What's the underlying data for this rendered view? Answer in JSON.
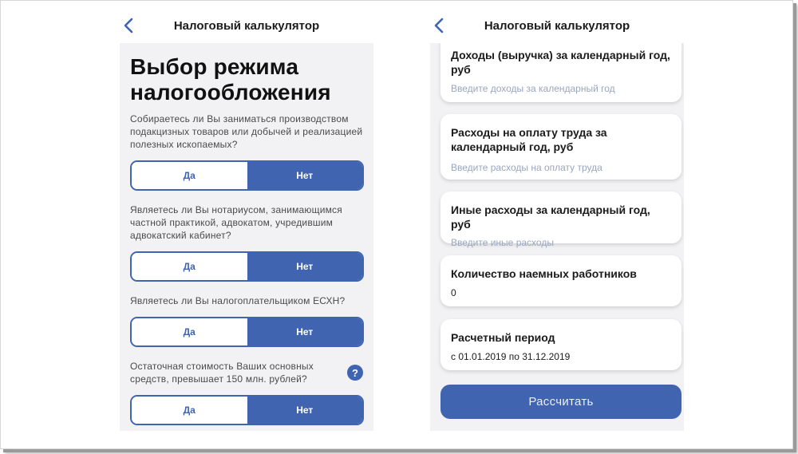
{
  "left": {
    "nav_title": "Налоговый калькулятор",
    "heading_line1": "Выбор режима",
    "heading_line2": "налогообложения",
    "questions": [
      {
        "lines": [
          "Собираетесь ли Вы заниматься производством",
          "подакцизных товаров или добычей и реализацией",
          "полезных ископаемых?"
        ],
        "yes": "Да",
        "no": "Нет",
        "selected": "Нет"
      },
      {
        "lines": [
          "Являетесь ли Вы нотариусом, занимающимся",
          "частной практикой, адвокатом, учредившим",
          "адвокатский кабинет?"
        ],
        "yes": "Да",
        "no": "Нет",
        "selected": "Нет"
      },
      {
        "lines": [
          "Являетесь ли Вы налогоплательщиком ЕСХН?"
        ],
        "yes": "Да",
        "no": "Нет",
        "selected": "Нет"
      },
      {
        "lines": [
          "Остаточная стоимость Ваших основных",
          "средств, превышает 150 млн. рублей?"
        ],
        "yes": "Да",
        "no": "Нет",
        "selected": "Нет",
        "help": "?"
      }
    ]
  },
  "right": {
    "nav_title": "Налоговый калькулятор",
    "fields": [
      {
        "label_lines": [
          "Доходы (выручка) за календарный год,",
          "руб"
        ],
        "placeholder": "Введите доходы за календарный год"
      },
      {
        "label_lines": [
          "Расходы на оплату труда за",
          "календарный год, руб"
        ],
        "placeholder": "Введите расходы на оплату труда"
      },
      {
        "label_lines": [
          "Иные расходы за календарный год, руб"
        ],
        "placeholder": "Введите иные расходы"
      },
      {
        "label_lines": [
          "Количество наемных работников"
        ],
        "value": "0"
      },
      {
        "label_lines": [
          "Расчетный период"
        ],
        "value": "с 01.01.2019 по 31.12.2019"
      }
    ],
    "calc_button": "Рассчитать"
  },
  "colors": {
    "accent": "#4064b0",
    "background": "#f2f2f4",
    "placeholder": "#9aa6bd"
  },
  "icons": {
    "back": "chevron-left-icon",
    "help": "question-circle-icon"
  }
}
